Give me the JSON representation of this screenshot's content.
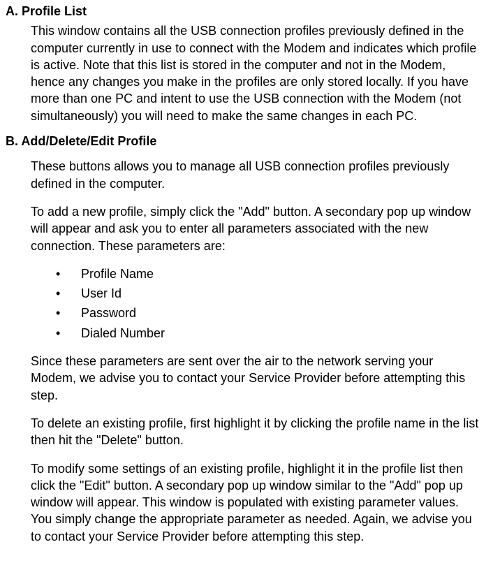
{
  "sectionA": {
    "heading": "A. Profile List",
    "para1": "This window contains all the USB connection profiles previously defined in the computer currently in use to connect with the Modem and indicates which profile is active. Note that this list is stored in the computer and not in the Modem, hence any changes you make in the profiles are only stored locally. If you have more than one PC and intent to use the USB connection with the Modem (not simultaneously) you will need to make the same changes in each PC."
  },
  "sectionB": {
    "heading": "B. Add/Delete/Edit Profile",
    "para1": "These buttons allows you to manage all USB connection profiles previously defined in the computer.",
    "para2": "To add a new profile, simply click the \"Add\" button. A secondary pop up window will appear and ask you to enter all parameters associated with the new connection. These parameters are:",
    "bullets": [
      "Profile Name",
      "User Id",
      "Password",
      "Dialed Number"
    ],
    "para3": "Since these parameters are sent over the air to the network serving your Modem, we advise you to contact your Service Provider before attempting this step.",
    "para4": "To delete an existing profile, first highlight it by clicking the profile name in the list then hit the \"Delete\" button.",
    "para5": "To modify some settings of an existing profile, highlight it in the profile list then click the \"Edit\" button. A secondary pop up window similar to the \"Add\" pop up window will appear. This window is populated with existing parameter values. You simply change the appropriate parameter as needed. Again, we advise you to contact your Service Provider before attempting this step."
  }
}
